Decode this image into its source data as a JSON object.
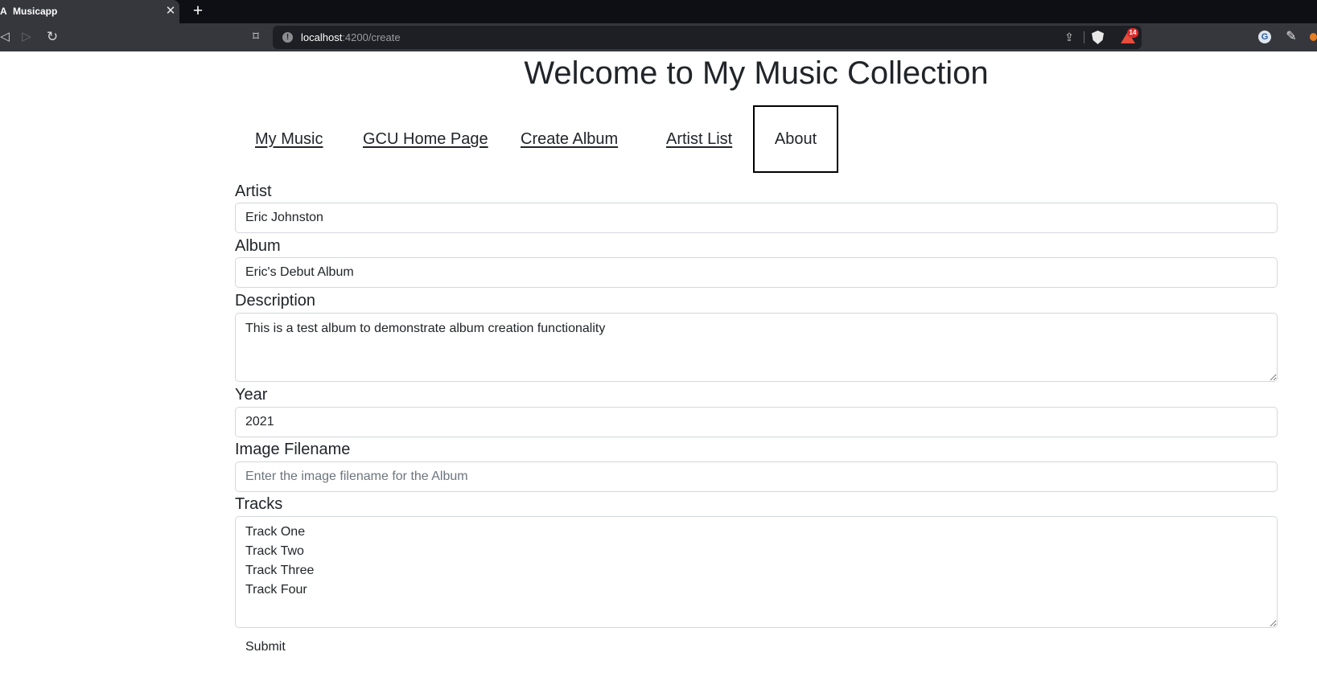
{
  "browser": {
    "tab": {
      "title": "Musicapp",
      "favicon": "angular-icon"
    },
    "address": {
      "host": "localhost",
      "path": ":4200/create"
    },
    "notification_count": "14"
  },
  "page": {
    "title": "Welcome to My Music Collection"
  },
  "nav": {
    "items": [
      {
        "label": "My Music"
      },
      {
        "label": "GCU Home Page"
      },
      {
        "label": "Create Album"
      },
      {
        "label": "Artist List"
      },
      {
        "label": "About"
      }
    ]
  },
  "form": {
    "artist": {
      "label": "Artist",
      "value": "Eric Johnston"
    },
    "album": {
      "label": "Album",
      "value": "Eric's Debut Album"
    },
    "description": {
      "label": "Description",
      "value": "This is a test album to demonstrate album creation functionality"
    },
    "year": {
      "label": "Year",
      "value": "2021"
    },
    "image": {
      "label": "Image Filename",
      "value": "",
      "placeholder": "Enter the image filename for the Album"
    },
    "tracks": {
      "label": "Tracks",
      "value": "Track One\nTrack Two\nTrack Three\nTrack Four"
    },
    "submit_label": "Submit"
  }
}
